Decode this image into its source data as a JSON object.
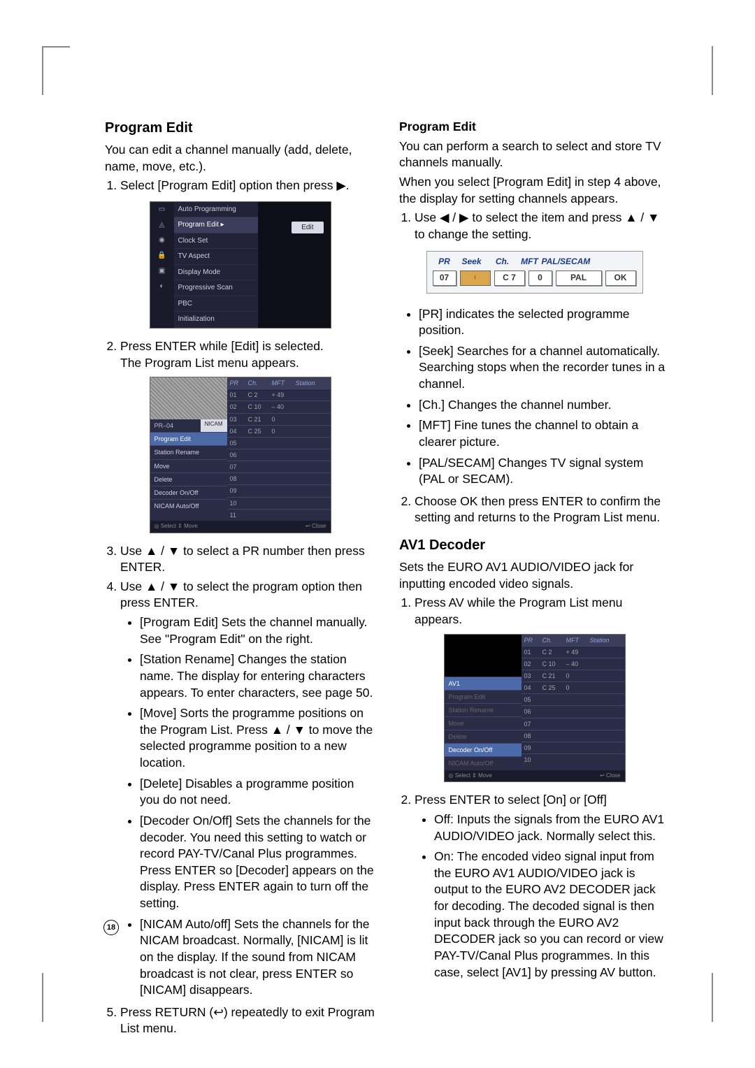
{
  "page_number": "18",
  "left": {
    "heading": "Program Edit",
    "intro": "You can edit a channel manually (add, delete, name, move, etc.).",
    "step1": "Select [Program Edit] option then press ▶.",
    "fig1_menu": {
      "items": [
        "Auto Programming",
        "Program Edit",
        "Clock Set",
        "TV Aspect",
        "Display Mode",
        "Progressive Scan",
        "PBC",
        "Initialization"
      ],
      "selected_index": 1,
      "button": "Edit"
    },
    "step2a": "Press ENTER while [Edit] is selected.",
    "step2b": "The Program List menu appears.",
    "fig2": {
      "headers": [
        "PR",
        "Ch.",
        "MFT",
        "Station"
      ],
      "rows": [
        [
          "01",
          "C 2",
          "+ 49",
          ""
        ],
        [
          "02",
          "C 10",
          "– 40",
          ""
        ],
        [
          "03",
          "C 21",
          "0",
          ""
        ],
        [
          "04",
          "C 25",
          "0",
          ""
        ],
        [
          "05",
          "",
          "",
          ""
        ],
        [
          "06",
          "",
          "",
          ""
        ],
        [
          "07",
          "",
          "",
          ""
        ],
        [
          "08",
          "",
          "",
          ""
        ],
        [
          "09",
          "",
          "",
          ""
        ],
        [
          "10",
          "",
          "",
          ""
        ],
        [
          "11",
          "",
          "",
          ""
        ]
      ],
      "pr_label": "PR–04",
      "nicam": "NICAM",
      "side": [
        "Program Edit",
        "Station Rename",
        "Move",
        "Delete",
        "Decoder On/Off",
        "NICAM Auto/Off"
      ],
      "bottom_left": "◎ Select  ⇕ Move",
      "bottom_right": "↩ Close"
    },
    "step3": "Use ▲ / ▼ to select a PR number then press ENTER.",
    "step4": "Use ▲ / ▼ to select the program option then press ENTER.",
    "opts": [
      "[Program Edit] Sets the channel manually. See \"Program Edit\" on the right.",
      "[Station Rename] Changes the station name. The display for entering characters appears. To enter characters, see page 50.",
      "[Move] Sorts the programme positions on the Program List. Press ▲ / ▼ to move the selected programme position to a new location.",
      "[Delete] Disables a programme position you do not need.",
      "[Decoder On/Off] Sets the channels for the decoder. You need this setting to watch or record PAY-TV/Canal Plus programmes. Press ENTER so [Decoder] appears on the display. Press ENTER again to turn off the setting.",
      "[NICAM Auto/off] Sets the channels for the NICAM broadcast. Normally, [NICAM] is lit on the display. If the sound from NICAM broadcast is not clear, press ENTER so [NICAM] disappears."
    ],
    "step5": "Press RETURN (↩) repeatedly to exit Program List menu."
  },
  "right": {
    "heading1": "Program Edit",
    "p1": "You can perform a search to select and store TV channels manually.",
    "p2": "When you select [Program Edit] in step 4 above, the display for setting channels appears.",
    "r_step1": "Use ◀ / ▶ to select the item and press ▲ / ▼ to change the setting.",
    "seek": {
      "labels": [
        "PR",
        "Seek",
        "Ch.",
        "MFT",
        "PAL/SECAM",
        ""
      ],
      "widths": [
        34,
        44,
        44,
        34,
        66,
        44
      ],
      "values": [
        "07",
        "↕",
        "C 7",
        "0",
        "PAL",
        "OK"
      ]
    },
    "bullets1": [
      "[PR] indicates the selected programme position.",
      "[Seek] Searches for a channel automatically. Searching stops when the recorder tunes in a channel.",
      "[Ch.] Changes the channel number.",
      "[MFT] Fine tunes the channel to obtain a clearer picture.",
      "[PAL/SECAM] Changes TV signal system (PAL or SECAM)."
    ],
    "r_step2": "Choose OK then press ENTER to confirm the setting and returns to the Program List menu.",
    "heading2": "AV1 Decoder",
    "av_p": "Sets the EURO AV1 AUDIO/VIDEO jack for inputting encoded video signals.",
    "av_step1": "Press AV while the Program List menu appears.",
    "fig3": {
      "headers": [
        "PR",
        "Ch.",
        "MFT",
        "Station"
      ],
      "rows": [
        [
          "01",
          "C 2",
          "+ 49",
          ""
        ],
        [
          "02",
          "C 10",
          "– 40",
          ""
        ],
        [
          "03",
          "C 21",
          "0",
          ""
        ],
        [
          "04",
          "C 25",
          "0",
          ""
        ],
        [
          "05",
          "",
          "",
          ""
        ],
        [
          "06",
          "",
          "",
          ""
        ],
        [
          "07",
          "",
          "",
          ""
        ],
        [
          "08",
          "",
          "",
          ""
        ],
        [
          "09",
          "",
          "",
          ""
        ],
        [
          "10",
          "",
          "",
          ""
        ]
      ],
      "av_label": "AV1",
      "side": [
        "Program Edit",
        "Station Rename",
        "Move",
        "Delete",
        "Decoder On/Off",
        "NICAM Auto/Off"
      ],
      "side_hl_index": 4,
      "bottom_left": "◎ Select  ⇕ Move",
      "bottom_right": "↩ Close"
    },
    "av_step2": "Press ENTER to select [On] or [Off]",
    "bullets2": [
      "Off: Inputs the signals from the EURO AV1 AUDIO/VIDEO jack. Normally select this.",
      "On: The encoded video signal input from the EURO AV1 AUDIO/VIDEO jack is output to the EURO AV2 DECODER jack for decoding. The decoded signal is then input back through the EURO AV2 DECODER jack so you can record or view PAY-TV/Canal Plus programmes. In this case, select [AV1] by pressing AV button."
    ]
  }
}
